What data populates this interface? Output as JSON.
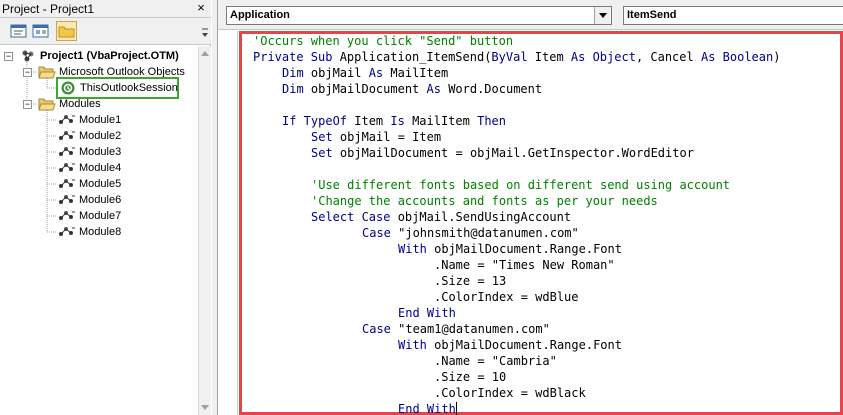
{
  "project_panel": {
    "title": "Project - Project1",
    "close_glyph": "×",
    "toolbar": {
      "view_code_icon": "view-code-icon",
      "view_object_icon": "view-object-icon",
      "toggle_folders_icon": "toggle-folders-icon"
    },
    "tree": {
      "root_label": "Project1 (VbaProject.OTM)",
      "folder_outlook": "Microsoft Outlook Objects",
      "this_outlook_session": "ThisOutlookSession",
      "folder_modules": "Modules",
      "modules": [
        "Module1",
        "Module2",
        "Module3",
        "Module4",
        "Module5",
        "Module6",
        "Module7",
        "Module8"
      ]
    }
  },
  "code_window": {
    "object_combo": "Application",
    "procedure_combo": "ItemSend",
    "lines": [
      {
        "indent": 2,
        "parts": [
          {
            "t": "cm",
            "v": "'Occurs when you click \"Send\" button"
          }
        ]
      },
      {
        "indent": 2,
        "parts": [
          {
            "t": "kw",
            "v": "Private Sub "
          },
          {
            "t": "tx",
            "v": "Application_ItemSend("
          },
          {
            "t": "kw",
            "v": "ByVal "
          },
          {
            "t": "tx",
            "v": "Item "
          },
          {
            "t": "kw",
            "v": "As Object"
          },
          {
            "t": "tx",
            "v": ", Cancel "
          },
          {
            "t": "kw",
            "v": "As Boolean"
          },
          {
            "t": "tx",
            "v": ")"
          }
        ]
      },
      {
        "indent": 6,
        "parts": [
          {
            "t": "kw",
            "v": "Dim "
          },
          {
            "t": "tx",
            "v": "objMail "
          },
          {
            "t": "kw",
            "v": "As "
          },
          {
            "t": "tx",
            "v": "MailItem"
          }
        ]
      },
      {
        "indent": 6,
        "parts": [
          {
            "t": "kw",
            "v": "Dim "
          },
          {
            "t": "tx",
            "v": "objMailDocument "
          },
          {
            "t": "kw",
            "v": "As "
          },
          {
            "t": "tx",
            "v": "Word.Document"
          }
        ]
      },
      {
        "indent": 0,
        "parts": []
      },
      {
        "indent": 6,
        "parts": [
          {
            "t": "kw",
            "v": "If TypeOf "
          },
          {
            "t": "tx",
            "v": "Item "
          },
          {
            "t": "kw",
            "v": "Is "
          },
          {
            "t": "tx",
            "v": "MailItem "
          },
          {
            "t": "kw",
            "v": "Then"
          }
        ]
      },
      {
        "indent": 10,
        "parts": [
          {
            "t": "kw",
            "v": "Set "
          },
          {
            "t": "tx",
            "v": "objMail = Item"
          }
        ]
      },
      {
        "indent": 10,
        "parts": [
          {
            "t": "kw",
            "v": "Set "
          },
          {
            "t": "tx",
            "v": "objMailDocument = objMail.GetInspector.WordEditor"
          }
        ]
      },
      {
        "indent": 0,
        "parts": []
      },
      {
        "indent": 10,
        "parts": [
          {
            "t": "cm",
            "v": "'Use different fonts based on different send using account"
          }
        ]
      },
      {
        "indent": 10,
        "parts": [
          {
            "t": "cm",
            "v": "'Change the accounts and fonts as per your needs"
          }
        ]
      },
      {
        "indent": 10,
        "parts": [
          {
            "t": "kw",
            "v": "Select Case "
          },
          {
            "t": "tx",
            "v": "objMail.SendUsingAccount"
          }
        ]
      },
      {
        "indent": 17,
        "parts": [
          {
            "t": "kw",
            "v": "Case "
          },
          {
            "t": "tx",
            "v": "\"johnsmith@datanumen.com\""
          }
        ]
      },
      {
        "indent": 22,
        "parts": [
          {
            "t": "kw",
            "v": "With "
          },
          {
            "t": "tx",
            "v": "objMailDocument.Range.Font"
          }
        ]
      },
      {
        "indent": 27,
        "parts": [
          {
            "t": "tx",
            "v": ".Name = \"Times New Roman\""
          }
        ]
      },
      {
        "indent": 27,
        "parts": [
          {
            "t": "tx",
            "v": ".Size = 13"
          }
        ]
      },
      {
        "indent": 27,
        "parts": [
          {
            "t": "tx",
            "v": ".ColorIndex = wdBlue"
          }
        ]
      },
      {
        "indent": 22,
        "parts": [
          {
            "t": "kw",
            "v": "End With"
          }
        ]
      },
      {
        "indent": 17,
        "parts": [
          {
            "t": "kw",
            "v": "Case "
          },
          {
            "t": "tx",
            "v": "\"team1@datanumen.com\""
          }
        ]
      },
      {
        "indent": 22,
        "parts": [
          {
            "t": "kw",
            "v": "With "
          },
          {
            "t": "tx",
            "v": "objMailDocument.Range.Font"
          }
        ]
      },
      {
        "indent": 27,
        "parts": [
          {
            "t": "tx",
            "v": ".Name = \"Cambria\""
          }
        ]
      },
      {
        "indent": 27,
        "parts": [
          {
            "t": "tx",
            "v": ".Size = 10"
          }
        ]
      },
      {
        "indent": 27,
        "parts": [
          {
            "t": "tx",
            "v": ".ColorIndex = wdBlack"
          }
        ]
      },
      {
        "indent": 22,
        "parts": [
          {
            "t": "kw",
            "v": "End With"
          }
        ],
        "cursor": true
      }
    ]
  },
  "colors": {
    "keyword": "#00008b",
    "comment": "#008000",
    "code_highlight_border": "#e0474c",
    "selection_border": "#3fa33a"
  }
}
